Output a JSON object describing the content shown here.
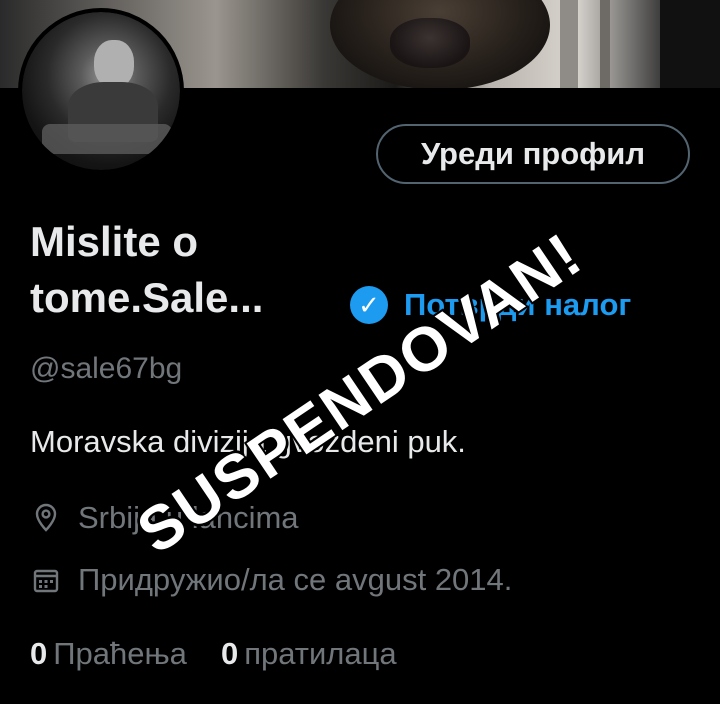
{
  "profile": {
    "edit_button": "Уреди профил",
    "name_line1": "Mislite o",
    "name_line2": "tome.Sale...",
    "verify_label": "Потврди налог",
    "handle": "@sale67bg",
    "bio": "Moravska divizija gvozdeni puk.",
    "location": "Srbija u lancima",
    "joined": "Придружио/ла се avgust 2014.",
    "following_count": "0",
    "following_label": "Праћења",
    "followers_count": "0",
    "followers_label": "пратилаца"
  },
  "overlay": {
    "stamp_text": "SUSPENDOVAN!"
  },
  "icons": {
    "location": "location-pin-icon",
    "calendar": "calendar-icon",
    "verified": "verified-badge-icon"
  },
  "colors": {
    "background": "#000000",
    "accent": "#1d9bf0",
    "muted": "#71767b",
    "text": "#e7e9ea"
  }
}
